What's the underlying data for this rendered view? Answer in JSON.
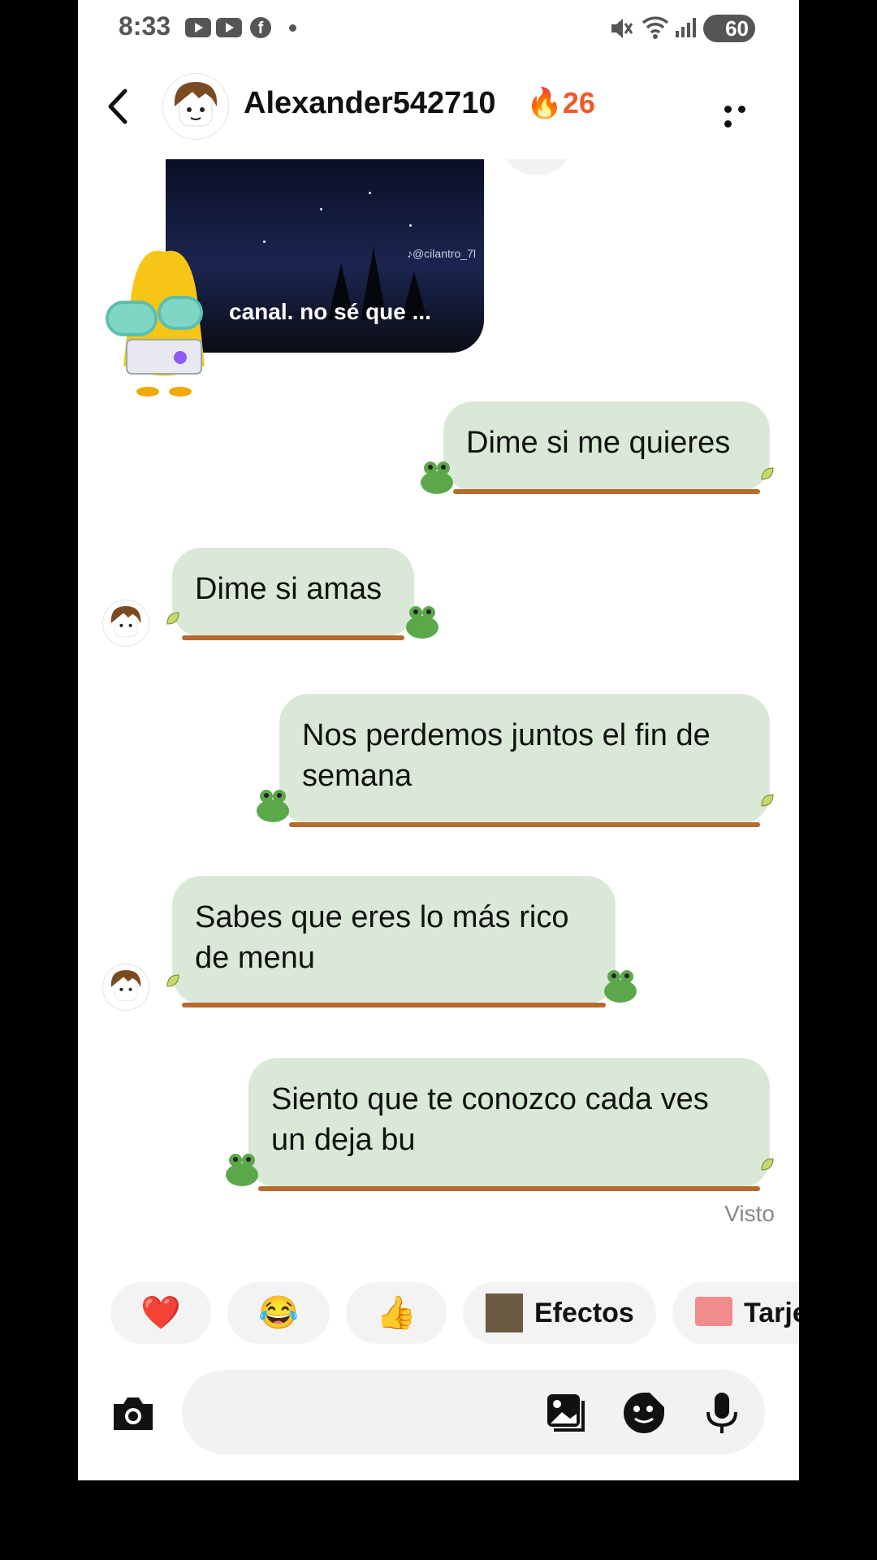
{
  "status_bar": {
    "time": "8:33",
    "battery": "60"
  },
  "header": {
    "username": "Alexander542710",
    "streak_icon": "🔥",
    "streak_count": "26"
  },
  "video_preview": {
    "watermark": "♪@cilantro_7l",
    "caption": "canal. no sé que ..."
  },
  "messages": [
    {
      "side": "right",
      "text": "Dime si me quieres"
    },
    {
      "side": "left",
      "text": "Dime si amas"
    },
    {
      "side": "right",
      "text": "Nos perdemos juntos el fin de semana"
    },
    {
      "side": "left",
      "text": "Sabes que eres lo más rico de menu"
    },
    {
      "side": "right",
      "text": "Siento que te conozco cada ves un deja bu"
    }
  ],
  "seen_label": "Visto",
  "quick_reactions": [
    {
      "icon": "heart-icon",
      "glyph": "❤️"
    },
    {
      "icon": "laughing-face-icon",
      "glyph": "😂"
    },
    {
      "icon": "thumbs-up-icon",
      "glyph": "👍"
    },
    {
      "icon": "effects-icon",
      "label": "Efectos"
    },
    {
      "icon": "gift-card-icon",
      "label": "Tarje"
    }
  ],
  "composer": {
    "placeholder": ""
  },
  "colors": {
    "bubble": "#dae9d7",
    "vine": "#b56a2e",
    "frog": "#5aa84a",
    "streak": "#f05a28"
  }
}
